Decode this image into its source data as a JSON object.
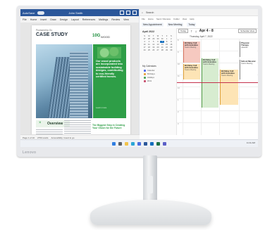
{
  "brand": "Lenovo",
  "word": {
    "title": "AutoSave",
    "doc_name": "John Smith",
    "menu": [
      "File",
      "Home",
      "Insert",
      "Draw",
      "Design",
      "Layout",
      "References",
      "Mailings",
      "Review",
      "View"
    ],
    "page": {
      "small_label": "Produced by Go",
      "title": "CASE STUDY",
      "logo_mark": "10G",
      "logo_word": "WOOD",
      "panel_text": "Our wood products are incorporated into sustainable building designs, contributing to eco-friendly certified homes.",
      "panel_more": "Learn more",
      "overview_label": "Overview",
      "callout": "The Biggest Step in Creating Your Vision for the Future"
    },
    "status": [
      "Page 1 of 10",
      "2750 words",
      "Accessibility: Good to go"
    ]
  },
  "outlook": {
    "title": "Search",
    "menu": [
      "File",
      "Home",
      "Send / Receive",
      "Folder",
      "View",
      "Help"
    ],
    "ribbon": [
      "New Appointment",
      "New Meeting",
      "Today"
    ],
    "mini_month": "April 2022",
    "weekdays": [
      "S",
      "M",
      "T",
      "W",
      "T",
      "F",
      "S"
    ],
    "days": [
      "27",
      "28",
      "29",
      "30",
      "31",
      "1",
      "2",
      "3",
      "4",
      "5",
      "6",
      "7",
      "8",
      "9",
      "10",
      "11",
      "12",
      "13",
      "14",
      "15",
      "16",
      "17",
      "18",
      "19",
      "20",
      "21",
      "22",
      "23",
      "24",
      "25",
      "26",
      "27",
      "28",
      "29",
      "30"
    ],
    "selected_day": "7",
    "my_calendars_label": "My Calendars",
    "calendars": [
      {
        "label": "Calendar",
        "color": "#4f6bed"
      },
      {
        "label": "Birthdays",
        "color": "#e8a33d"
      },
      {
        "label": "Holidays",
        "color": "#49a55a"
      },
      {
        "label": "Work",
        "color": "#c94f6d"
      }
    ],
    "nav": {
      "today": "Today",
      "range": "Apr 4 - 8",
      "view": "Schedule View"
    },
    "date_header": "Thursday, April 7, 2022",
    "hours": [
      "8",
      "9",
      "10",
      "11",
      "12",
      "1",
      "2",
      "3"
    ],
    "events": [
      {
        "title": "Birthday Call with Grandma",
        "sub": "Teams Meeting",
        "color": "#f6c9c0",
        "border": "#d9745f"
      },
      {
        "title": "Physical Therapy",
        "sub": "Lakeside",
        "color": "#ffffff",
        "border": "#8b8b8b"
      },
      {
        "title": "Birthday Call with Grandma",
        "sub": "Teams Meeting",
        "color": "#fde4b5",
        "border": "#e0a23a"
      },
      {
        "title": "Birthday Call with Grandma",
        "sub": "Teams Meeting",
        "color": "#d7ecd0",
        "border": "#56a14a"
      },
      {
        "title": "School Musical",
        "sub": "Teams Meeting",
        "color": "#ffffff",
        "border": "#8b8b8b"
      },
      {
        "title": "Birthday Call with Grandma",
        "sub": "Teams Meeting",
        "color": "#fde4b5",
        "border": "#e0a23a"
      }
    ]
  },
  "taskbar": {
    "icons": [
      {
        "name": "start-icon",
        "color": "#2f7de1"
      },
      {
        "name": "search-icon",
        "color": "#5a5f66"
      },
      {
        "name": "file-explorer-icon",
        "color": "#f2c34a"
      },
      {
        "name": "edge-icon",
        "color": "#2aa6d6"
      },
      {
        "name": "store-icon",
        "color": "#4b6ee0"
      },
      {
        "name": "word-icon",
        "color": "#2b579a"
      },
      {
        "name": "outlook-icon",
        "color": "#0f6cbd"
      },
      {
        "name": "excel-icon",
        "color": "#1e7145"
      },
      {
        "name": "teams-icon",
        "color": "#5b5fc7"
      }
    ],
    "clock": "11:11 AM"
  }
}
